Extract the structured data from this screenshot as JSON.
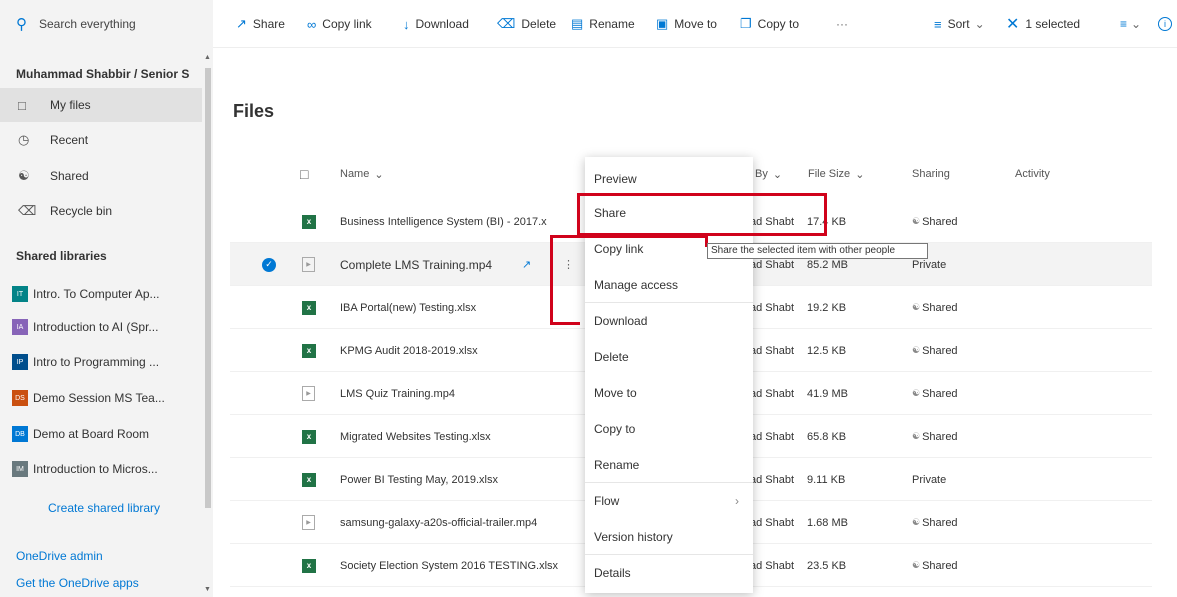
{
  "search": {
    "placeholder": "Search everything"
  },
  "commandbar": {
    "share": "Share",
    "copy_link": "Copy link",
    "download": "Download",
    "delete": "Delete",
    "rename": "Rename",
    "move_to": "Move to",
    "copy_to": "Copy to",
    "more": "···",
    "sort": "Sort",
    "selected": "1 selected"
  },
  "sidebar": {
    "breadcrumb": "Muhammad Shabbir / Senior S",
    "nav": [
      {
        "label": "My files",
        "icon": "folder-icon"
      },
      {
        "label": "Recent",
        "icon": "clock-icon"
      },
      {
        "label": "Shared",
        "icon": "people-icon"
      },
      {
        "label": "Recycle bin",
        "icon": "recycle-bin-icon"
      }
    ],
    "shared_libraries_title": "Shared libraries",
    "libraries": [
      {
        "badge": "IT",
        "label": "Intro. To Computer Ap...",
        "color": "#038387"
      },
      {
        "badge": "IA",
        "label": "Introduction to AI (Spr...",
        "color": "#8764b8"
      },
      {
        "badge": "IP",
        "label": "Intro to Programming ...",
        "color": "#004e8c"
      },
      {
        "badge": "DS",
        "label": "Demo Session MS Tea...",
        "color": "#ca5010"
      },
      {
        "badge": "DB",
        "label": "Demo at Board Room",
        "color": "#0078d4"
      },
      {
        "badge": "IM",
        "label": "Introduction to Micros...",
        "color": "#69797e"
      }
    ],
    "create_library": "Create shared library",
    "onedrive_admin": "OneDrive admin",
    "get_apps": "Get the OneDrive apps"
  },
  "main": {
    "title": "Files",
    "columns": {
      "name": "Name",
      "modified_by": "By",
      "file_size": "File Size",
      "sharing": "Sharing",
      "activity": "Activity"
    },
    "rows": [
      {
        "name": "Business Intelligence System (BI) - 2017.x",
        "type": "xlsx",
        "by": "ad Shabt",
        "size": "17.4 KB",
        "sharing": "Shared",
        "selected": false
      },
      {
        "name": "Complete LMS Training.mp4",
        "type": "mp4",
        "by": "ad Shabt",
        "size": "85.2 MB",
        "sharing": "Private",
        "selected": true
      },
      {
        "name": "IBA Portal(new) Testing.xlsx",
        "type": "xlsx",
        "by": "ad Shabt",
        "size": "19.2 KB",
        "sharing": "Shared",
        "selected": false
      },
      {
        "name": "KPMG Audit 2018-2019.xlsx",
        "type": "xlsx",
        "by": "ad Shabt",
        "size": "12.5 KB",
        "sharing": "Shared",
        "selected": false
      },
      {
        "name": "LMS Quiz Training.mp4",
        "type": "mp4",
        "by": "ad Shabt",
        "size": "41.9 MB",
        "sharing": "Shared",
        "selected": false
      },
      {
        "name": "Migrated Websites Testing.xlsx",
        "type": "xlsx",
        "by": "ad Shabt",
        "size": "65.8 KB",
        "sharing": "Shared",
        "selected": false
      },
      {
        "name": "Power BI Testing May, 2019.xlsx",
        "type": "xlsx",
        "by": "ad Shabt",
        "size": "9.11 KB",
        "sharing": "Private",
        "selected": false
      },
      {
        "name": "samsung-galaxy-a20s-official-trailer.mp4",
        "type": "mp4",
        "by": "ad Shabt",
        "size": "1.68 MB",
        "sharing": "Shared",
        "selected": false
      },
      {
        "name": "Society Election System 2016 TESTING.xlsx",
        "type": "xlsx",
        "by": "ad Shabt",
        "size": "23.5 KB",
        "sharing": "Shared",
        "selected": false
      }
    ]
  },
  "context_menu": {
    "items": [
      "Preview",
      "Share",
      "Copy link",
      "Manage access",
      "Download",
      "Delete",
      "Move to",
      "Copy to",
      "Rename",
      "Flow",
      "Version history",
      "Details"
    ]
  },
  "tooltip": "Share the selected item with other people",
  "colors": {
    "accent": "#0078d4",
    "highlight": "#d0021b",
    "excel": "#217346"
  }
}
